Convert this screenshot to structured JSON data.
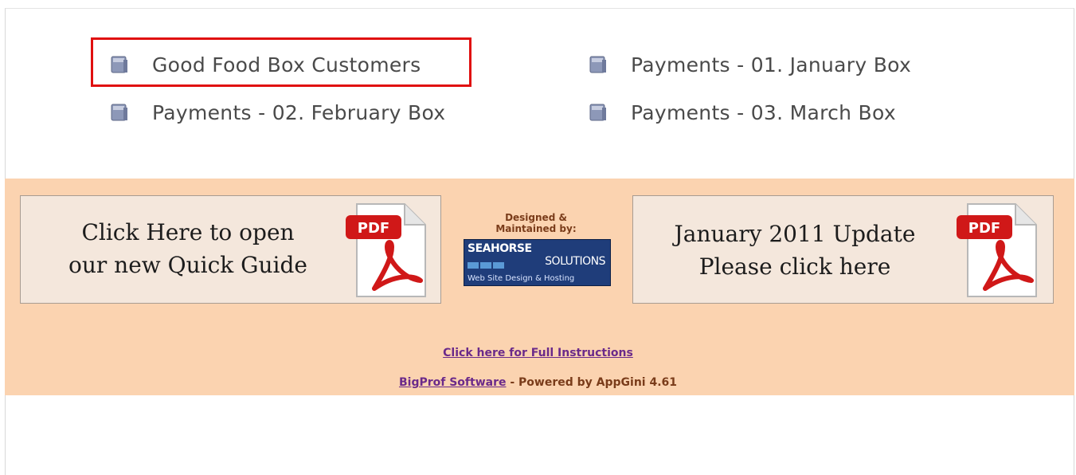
{
  "nav": {
    "items": [
      {
        "label": "Good Food Box Customers",
        "icon": "table-icon",
        "highlighted": true
      },
      {
        "label": "Payments - 01. January Box",
        "icon": "table-icon"
      },
      {
        "label": "Payments - 02. February Box",
        "icon": "table-icon"
      },
      {
        "label": "Payments - 03. March Box",
        "icon": "table-icon"
      }
    ]
  },
  "banners": {
    "quick_guide": {
      "line1": "Click Here to open",
      "line2": "our new Quick Guide",
      "badge": "PDF"
    },
    "update": {
      "line1": "January 2011 Update",
      "line2": "Please click here",
      "badge": "PDF"
    }
  },
  "credit": {
    "designed_line1": "Designed &",
    "designed_line2": "Maintained by:",
    "logo_top": "SEAHORSE",
    "logo_mid": "SOLUTIONS",
    "logo_sub": "Web Site Design & Hosting"
  },
  "footer": {
    "instructions_link": "Click here for Full Instructions",
    "bigprof_link": "BigProf Software",
    "powered_by": " - Powered by AppGini 4.61"
  },
  "colors": {
    "band": "#fbd3b0",
    "highlight": "#e01010",
    "link": "#6b2a8a"
  }
}
